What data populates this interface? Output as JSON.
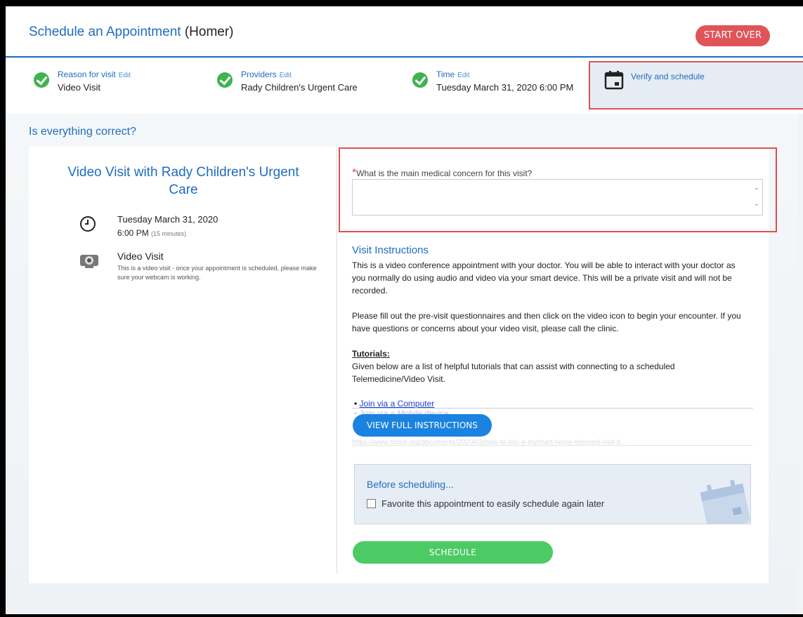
{
  "header": {
    "title": "Schedule an Appointment",
    "patient": "(Homer)",
    "start_over": "START OVER"
  },
  "steps": [
    {
      "label": "Reason for visit",
      "edit": "Edit",
      "value": "Video Visit"
    },
    {
      "label": "Providers",
      "edit": "Edit",
      "value": "Rady Children's Urgent Care"
    },
    {
      "label": "Time",
      "edit": "Edit",
      "value": "Tuesday March 31, 2020 6:00 PM"
    }
  ],
  "verify_step": {
    "label": "Verify and schedule"
  },
  "question": "Is everything correct?",
  "summary": {
    "title": "Video Visit with Rady Children's Urgent Care",
    "date": "Tuesday March 31, 2020",
    "time": "6:00 PM",
    "duration": "(15 minutes)",
    "visit_type": "Video Visit",
    "visit_desc": "This is a video visit - once your appointment is scheduled, please make sure your webcam is working."
  },
  "concern": {
    "required_mark": "*",
    "label": "What is the main medical concern for this visit?",
    "value": ""
  },
  "instructions": {
    "title": "Visit Instructions",
    "p1": "This is a video conference appointment with your doctor. You will be able to interact with your doctor as you normally do using audio and video via your smart device. This will be a private visit and will not be recorded.",
    "p2": "Please fill out the pre-visit questionnaires and then click on the video icon to begin your encounter. If you have questions or concerns about your video visit, please call the clinic.",
    "tutorials_heading": "Tutorials:",
    "tutorials_text": "Given below are a list of helpful tutorials that can assist with connecting to a scheduled Telemedicine/Video Visit.",
    "link1": "Join via a Computer",
    "link2": "Join via a Mobile device",
    "view_full": "VIEW FULL INSTRUCTIONS",
    "url": "https://www.rchsd.org/documents/2020/03/how-to-join-a-mychart-home-telemed-visit-b..."
  },
  "before": {
    "title": "Before scheduling...",
    "favorite_label": "Favorite this appointment to easily schedule again later",
    "favorite_checked": false
  },
  "schedule_button": "SCHEDULE",
  "colors": {
    "primary": "#1f6cbf",
    "success": "#3fb34f",
    "danger": "#e05459",
    "schedule": "#4ccb64",
    "view_full": "#1a83e0"
  }
}
